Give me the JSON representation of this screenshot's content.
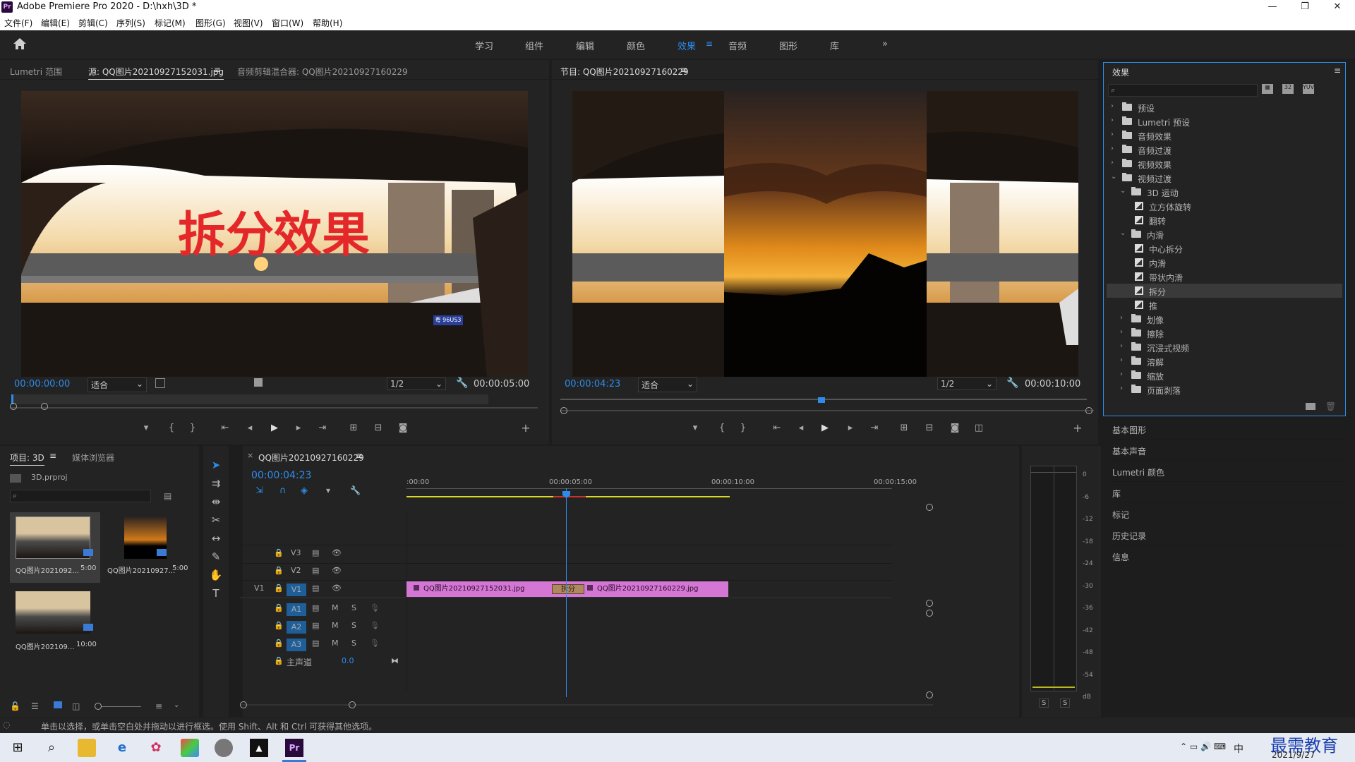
{
  "window": {
    "title": "Adobe Premiere Pro 2020 - D:\\hxh\\3D *",
    "logo": "Pr",
    "controls": [
      "—",
      "❐",
      "✕"
    ]
  },
  "menu": [
    "文件(F)",
    "编辑(E)",
    "剪辑(C)",
    "序列(S)",
    "标记(M)",
    "图形(G)",
    "视图(V)",
    "窗口(W)",
    "帮助(H)"
  ],
  "workspaces": {
    "items": [
      "学习",
      "组件",
      "编辑",
      "颜色",
      "效果",
      "音频",
      "图形",
      "库"
    ],
    "active": "效果",
    "more": "»"
  },
  "source_monitor": {
    "tabs": [
      "Lumetri 范围",
      "源: QQ图片20210927152031.jpg",
      "音频剪辑混合器: QQ图片20210927160229"
    ],
    "overlay_text": "拆分效果",
    "plate": "粤 96US3",
    "timecode_current": "00:00:00:00",
    "timecode_duration": "00:00:05:00",
    "fit": "适合",
    "resolution": "1/2"
  },
  "program_monitor": {
    "tab": "节目: QQ图片20210927160229",
    "timecode_current": "00:00:04:23",
    "timecode_duration": "00:00:10:00",
    "fit": "适合",
    "resolution": "1/2"
  },
  "effects_panel": {
    "title": "效果",
    "search_placeholder": "",
    "tree": [
      {
        "label": "预设",
        "level": 0,
        "kind": "folder",
        "expanded": false
      },
      {
        "label": "Lumetri 预设",
        "level": 0,
        "kind": "folder",
        "expanded": false
      },
      {
        "label": "音频效果",
        "level": 0,
        "kind": "folder",
        "expanded": false
      },
      {
        "label": "音频过渡",
        "level": 0,
        "kind": "folder",
        "expanded": false
      },
      {
        "label": "视频效果",
        "level": 0,
        "kind": "folder",
        "expanded": false
      },
      {
        "label": "视频过渡",
        "level": 0,
        "kind": "folder",
        "expanded": true
      },
      {
        "label": "3D 运动",
        "level": 1,
        "kind": "folder",
        "expanded": true
      },
      {
        "label": "立方体旋转",
        "level": 2,
        "kind": "fx"
      },
      {
        "label": "翻转",
        "level": 2,
        "kind": "fx"
      },
      {
        "label": "内滑",
        "level": 1,
        "kind": "folder",
        "expanded": true
      },
      {
        "label": "中心拆分",
        "level": 2,
        "kind": "fx"
      },
      {
        "label": "内滑",
        "level": 2,
        "kind": "fx"
      },
      {
        "label": "带状内滑",
        "level": 2,
        "kind": "fx"
      },
      {
        "label": "拆分",
        "level": 2,
        "kind": "fx",
        "selected": true
      },
      {
        "label": "推",
        "level": 2,
        "kind": "fx"
      },
      {
        "label": "划像",
        "level": 1,
        "kind": "folder",
        "expanded": false
      },
      {
        "label": "擦除",
        "level": 1,
        "kind": "folder",
        "expanded": false
      },
      {
        "label": "沉浸式视频",
        "level": 1,
        "kind": "folder",
        "expanded": false
      },
      {
        "label": "溶解",
        "level": 1,
        "kind": "folder",
        "expanded": false
      },
      {
        "label": "缩放",
        "level": 1,
        "kind": "folder",
        "expanded": false
      },
      {
        "label": "页面剥落",
        "level": 1,
        "kind": "folder",
        "expanded": false
      }
    ]
  },
  "side_panels": [
    "基本图形",
    "基本声音",
    "Lumetri 颜色",
    "库",
    "标记",
    "历史记录",
    "信息"
  ],
  "project_panel": {
    "tabs": [
      "项目: 3D",
      "媒体浏览器"
    ],
    "file": "3D.prproj",
    "items": [
      {
        "name": "QQ图片2021092...",
        "duration": "5:00"
      },
      {
        "name": "QQ图片20210927...",
        "duration": "5:00"
      },
      {
        "name": "QQ图片202109...",
        "duration": "10:00"
      }
    ]
  },
  "timeline": {
    "tab": "QQ图片20210927160229",
    "timecode": "00:00:04:23",
    "ruler": [
      ":00:00",
      "00:00:05:00",
      "00:00:10:00",
      "00:00:15:00"
    ],
    "tracks": {
      "video": [
        {
          "id": "V3",
          "label": "V3"
        },
        {
          "id": "V2",
          "label": "V2"
        },
        {
          "id": "V1",
          "label": "V1",
          "source": "V1"
        }
      ],
      "audio": [
        {
          "id": "A1",
          "label": "A1"
        },
        {
          "id": "A2",
          "label": "A2"
        },
        {
          "id": "A3",
          "label": "A3"
        }
      ],
      "master": {
        "label": "主声道",
        "value": "0.0"
      },
      "m": "M",
      "s": "S"
    },
    "clips": [
      {
        "name": "QQ图片20210927152031.jpg"
      },
      {
        "name": "QQ图片20210927160229.jpg"
      }
    ],
    "transition": "拆分"
  },
  "audio_meter": {
    "ticks": [
      "0",
      "-6",
      "-12",
      "-18",
      "-24",
      "-30",
      "-36",
      "-42",
      "-48",
      "-54",
      "dB"
    ],
    "solo": [
      "S",
      "S"
    ]
  },
  "status_text": "单击以选择，或单击空白处并拖动以进行框选。使用 Shift、Alt 和 Ctrl 可获得其他选项。",
  "taskbar": {
    "date": "2021/9/27",
    "watermark": "最需教育",
    "ime": "中"
  }
}
